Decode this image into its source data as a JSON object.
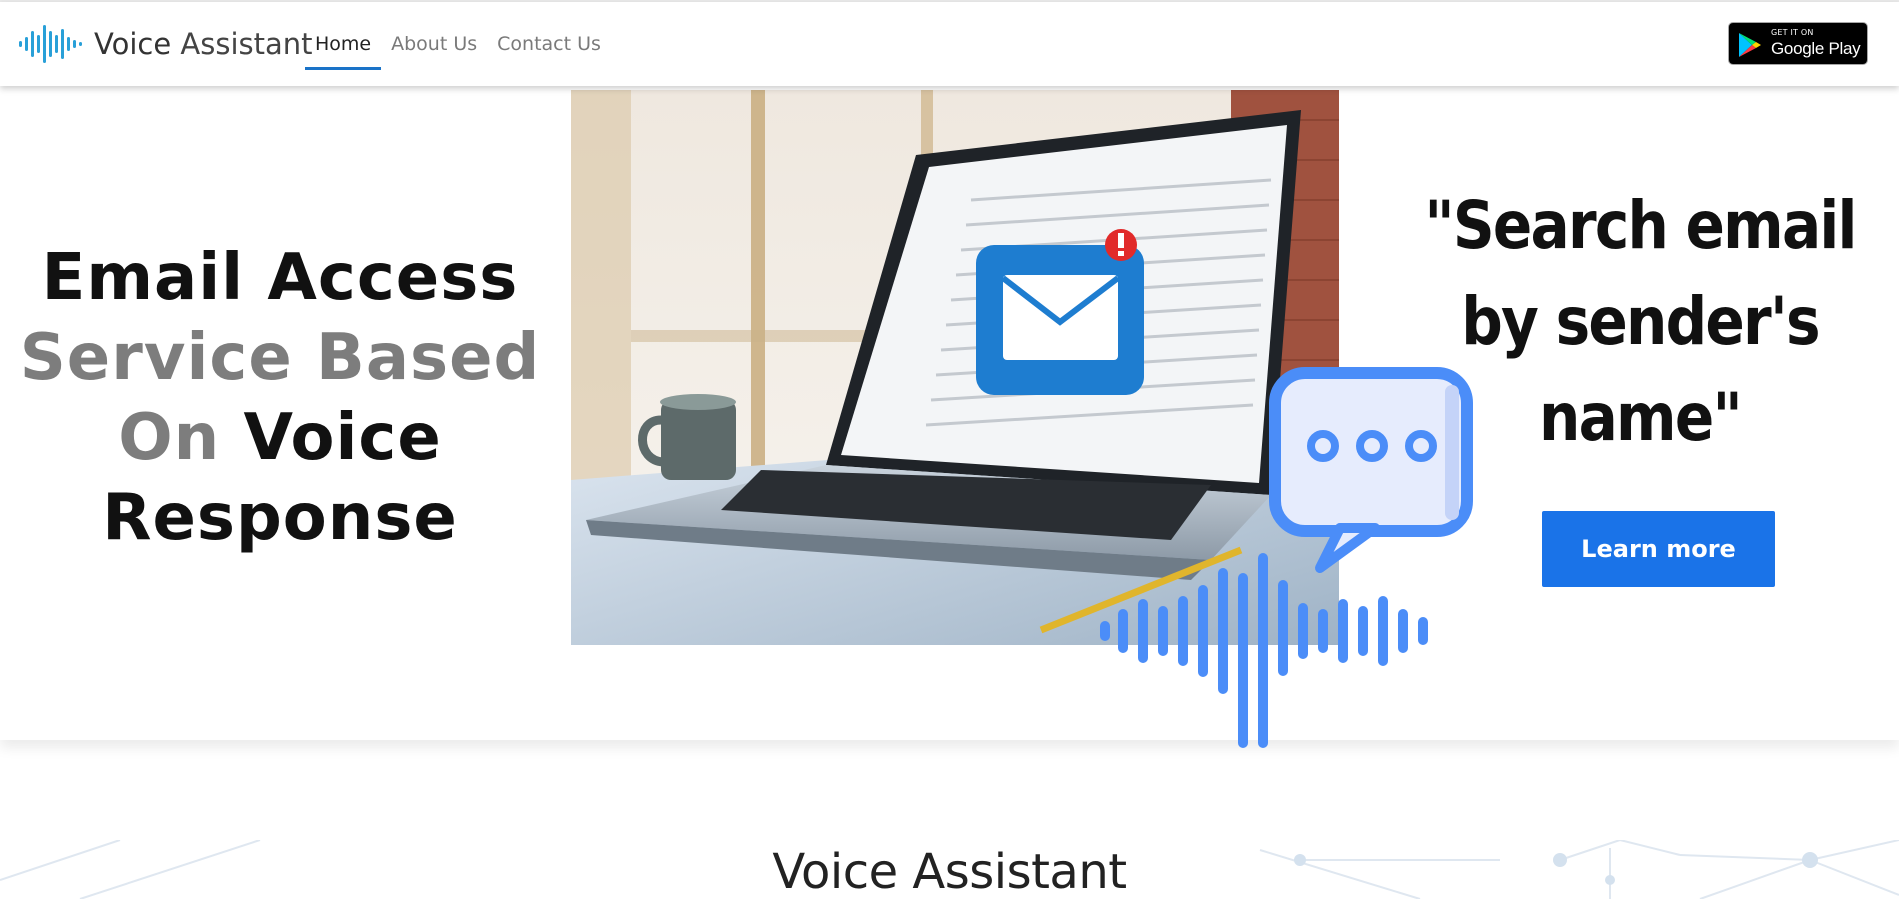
{
  "navbar": {
    "brand": {
      "strong": "Voice",
      "rest": " Assistant"
    },
    "links": [
      {
        "label": "Home",
        "active": true
      },
      {
        "label": "About Us",
        "active": false
      },
      {
        "label": "Contact Us",
        "active": false
      }
    ],
    "google_play": {
      "small": "GET IT ON",
      "big": "Google Play"
    }
  },
  "hero": {
    "title": {
      "line1": "Email Access",
      "line2": "Service Based",
      "line3a": "On",
      "line3b": "Voice",
      "line4": "Response"
    },
    "quote": {
      "line1": "\"Search email",
      "line2": "by sender's",
      "line3": "name\""
    },
    "button_label": "Learn more"
  },
  "section": {
    "title": "Voice Assistant"
  },
  "colors": {
    "accent": "#1a73e8",
    "nav_underline": "#1a73c8",
    "voice_blue": "#4b8df8",
    "email_blue": "#1e7dd0"
  },
  "icons": [
    "soundwave-logo-icon",
    "google-play-logo-icon",
    "email-envelope-icon",
    "alert-badge-icon",
    "chat-bubble-icon",
    "voice-wave-icon"
  ]
}
